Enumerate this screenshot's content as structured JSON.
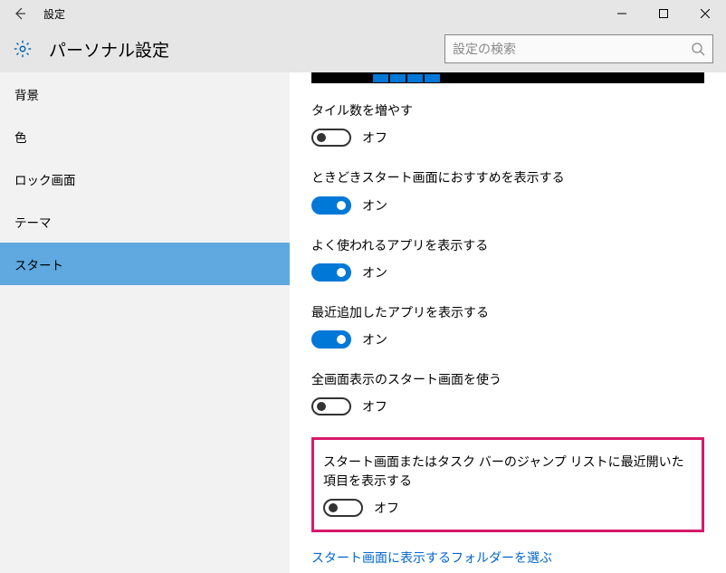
{
  "titlebar": {
    "title": "設定"
  },
  "header": {
    "title": "パーソナル設定",
    "search_placeholder": "設定の検索"
  },
  "sidebar": {
    "items": [
      {
        "label": "背景",
        "active": false
      },
      {
        "label": "色",
        "active": false
      },
      {
        "label": "ロック画面",
        "active": false
      },
      {
        "label": "テーマ",
        "active": false
      },
      {
        "label": "スタート",
        "active": true
      }
    ]
  },
  "settings": [
    {
      "label": "タイル数を増やす",
      "on": false,
      "state": "オフ"
    },
    {
      "label": "ときどきスタート画面におすすめを表示する",
      "on": true,
      "state": "オン"
    },
    {
      "label": "よく使われるアプリを表示する",
      "on": true,
      "state": "オン"
    },
    {
      "label": "最近追加したアプリを表示する",
      "on": true,
      "state": "オン"
    },
    {
      "label": "全画面表示のスタート画面を使う",
      "on": false,
      "state": "オフ"
    },
    {
      "label": "スタート画面またはタスク バーのジャンプ リストに最近開いた項目を表示する",
      "on": false,
      "state": "オフ",
      "highlight": true
    }
  ],
  "link": {
    "label": "スタート画面に表示するフォルダーを選ぶ"
  }
}
